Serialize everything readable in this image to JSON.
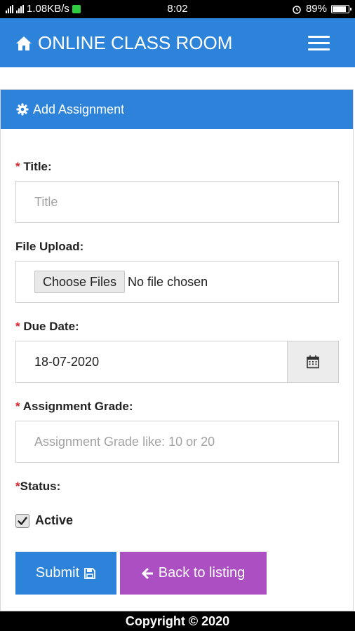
{
  "status_bar": {
    "network_speed": "1.08KB/s",
    "time": "8:02",
    "battery": "89%",
    "icons": [
      "signal-icon",
      "notification-icon",
      "alarm-icon",
      "battery-icon"
    ]
  },
  "navbar": {
    "brand": "ONLINE CLASS ROOM",
    "brand_icon": "home-icon",
    "menu_icon": "hamburger-menu-icon",
    "color": "#2d82d9"
  },
  "card": {
    "title": "Add Assignment",
    "title_icon": "gear-icon"
  },
  "form": {
    "title_label": "Title:",
    "title_placeholder": "Title",
    "file_label": "File Upload:",
    "file_button": "Choose Files",
    "file_status": "No file chosen",
    "due_date_label": "Due Date:",
    "due_date_value": "18-07-2020",
    "grade_label": "Assignment Grade:",
    "grade_placeholder": "Assignment Grade like: 10 or 20",
    "status_label": "Status:",
    "active_label": "Active",
    "active_checked": true,
    "required_mark": "*"
  },
  "buttons": {
    "submit": "Submit",
    "back": "Back to listing",
    "submit_color": "#2d82d9",
    "back_color": "#ab4fc2"
  },
  "footer": {
    "text": "Copyright © 2020"
  }
}
